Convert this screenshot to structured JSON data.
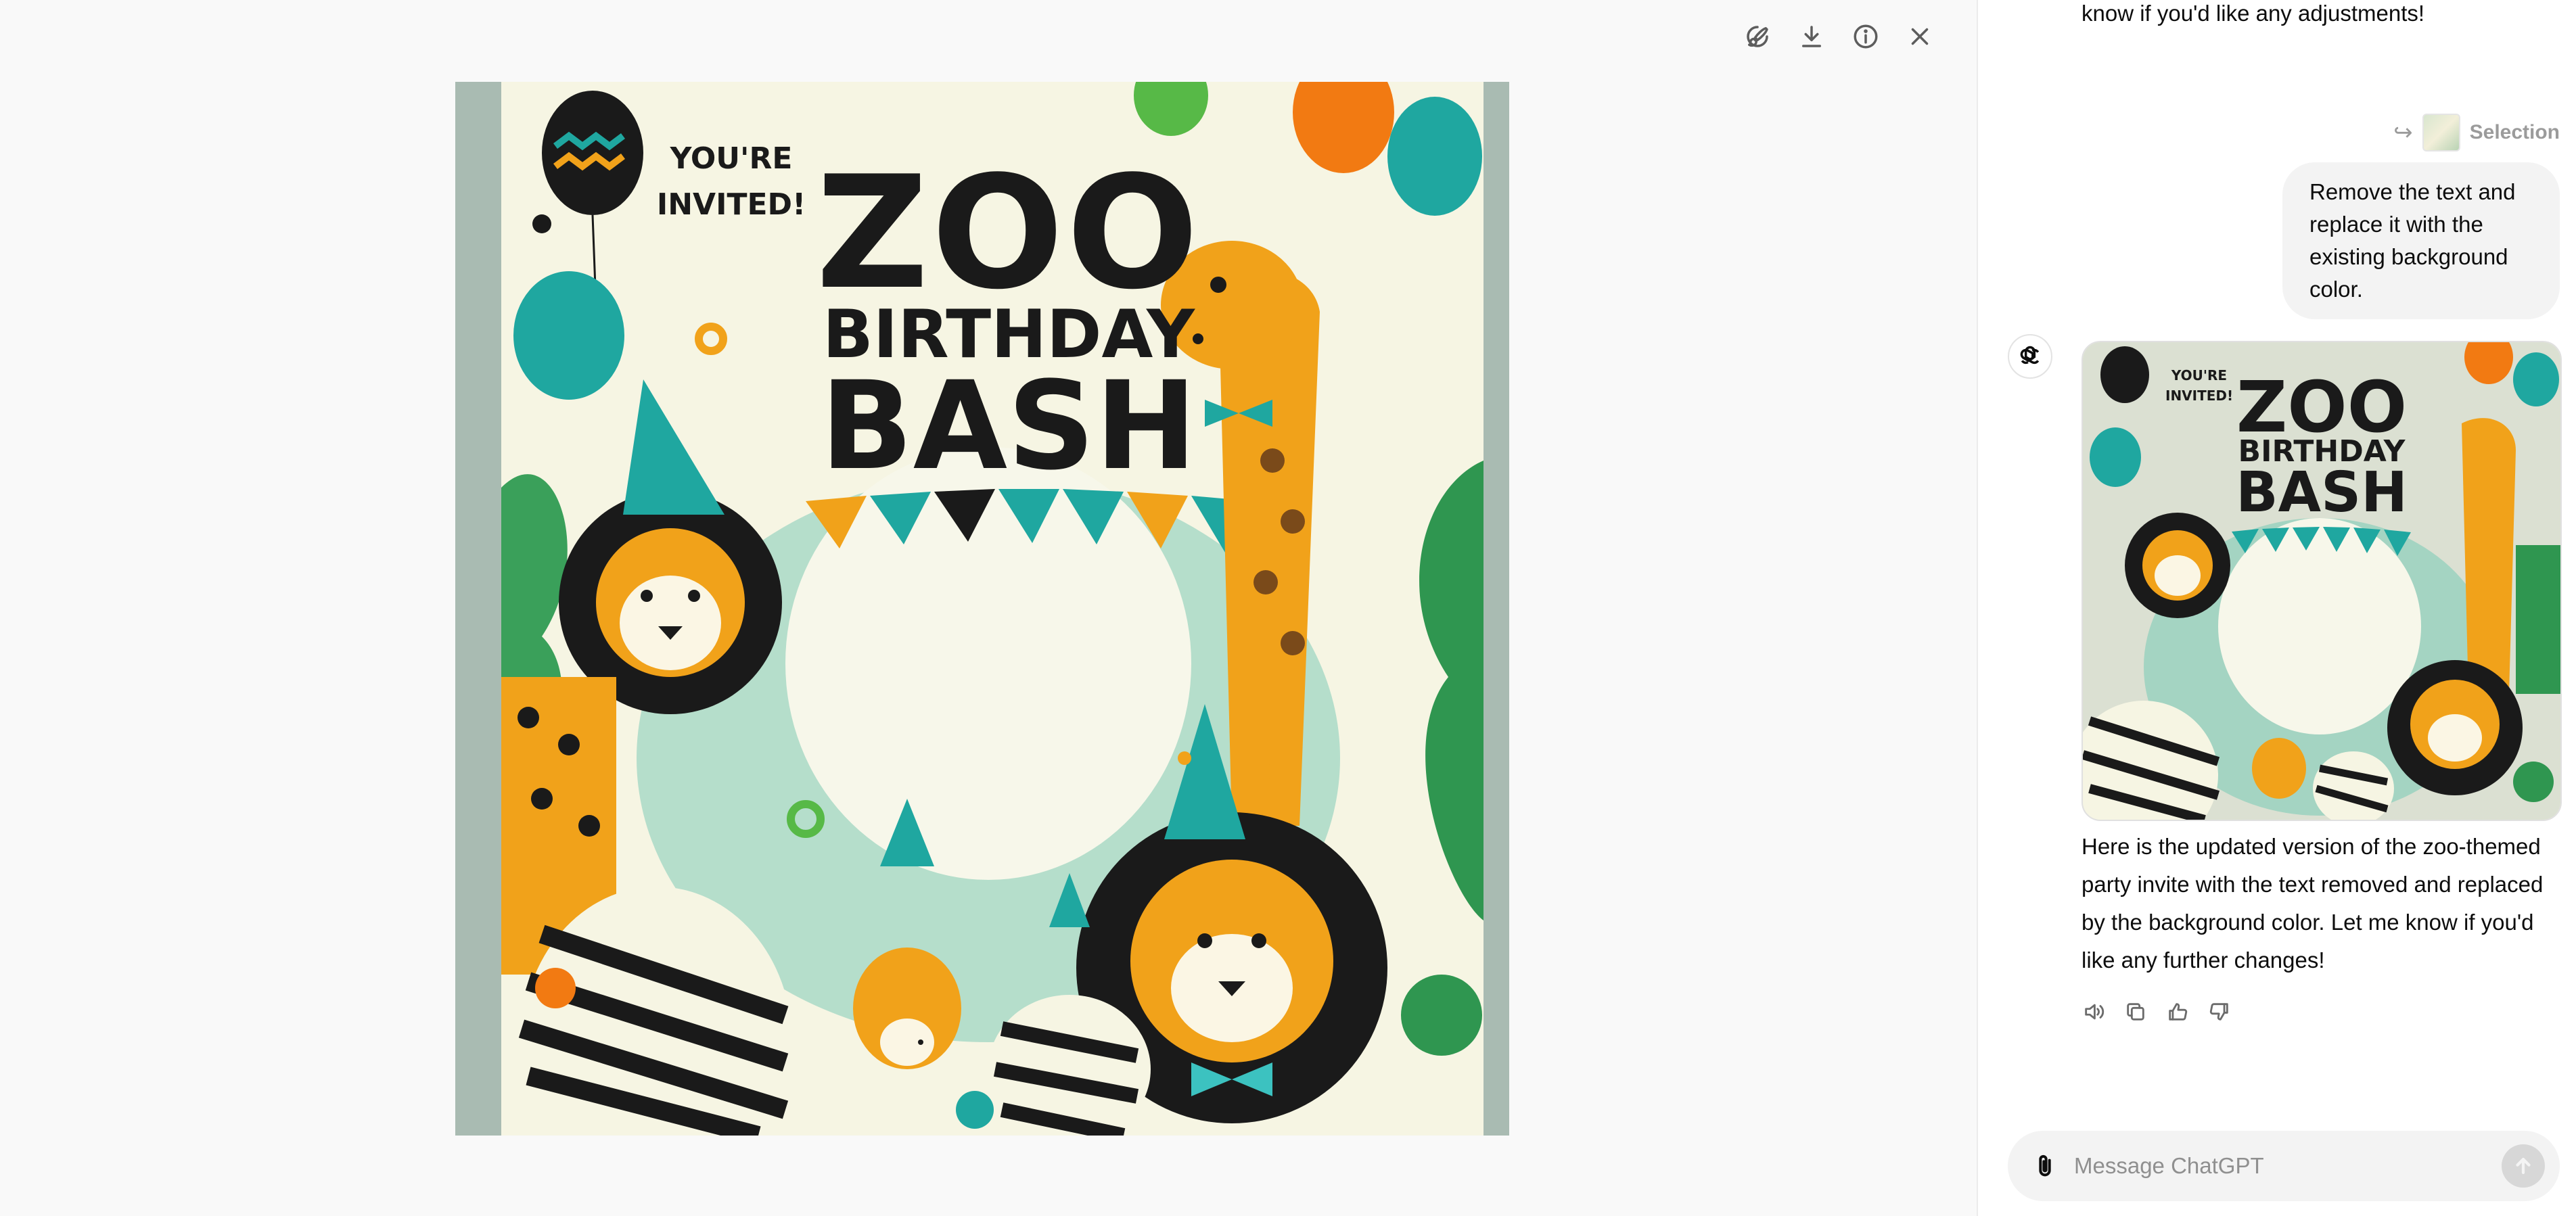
{
  "viewer": {
    "artwork_text": {
      "invited": "YOU'RE\nINVITED!",
      "zoo": "ZOO",
      "birthday": "BIRTHDAY",
      "bash": "BASH"
    },
    "toolbar": {
      "edit_icon": "brush-edit-icon",
      "download_icon": "download-icon",
      "info_icon": "info-icon",
      "close_icon": "close-icon"
    }
  },
  "chat": {
    "previous_message_tail": "know if you'd like any adjustments!",
    "selection_label": "Selection",
    "user_message": "Remove the text and replace it with the existing background color.",
    "assistant_reply": "Here is the updated version of the zoo-themed party invite with the text removed and replaced by the background color. Let me know if you'd like any further changes!",
    "thumbnail_text": {
      "invited": "YOU'RE\nINVITED!",
      "zoo": "ZOO",
      "birthday": "BIRTHDAY",
      "bash": "BASH"
    }
  },
  "composer": {
    "placeholder": "Message ChatGPT"
  },
  "colors": {
    "background": "#f9f9f9",
    "panel": "#ffffff",
    "bubble": "#f3f3f3",
    "teal": "#1fa7a0",
    "orange": "#f1a21a",
    "black": "#1a1a1a"
  }
}
